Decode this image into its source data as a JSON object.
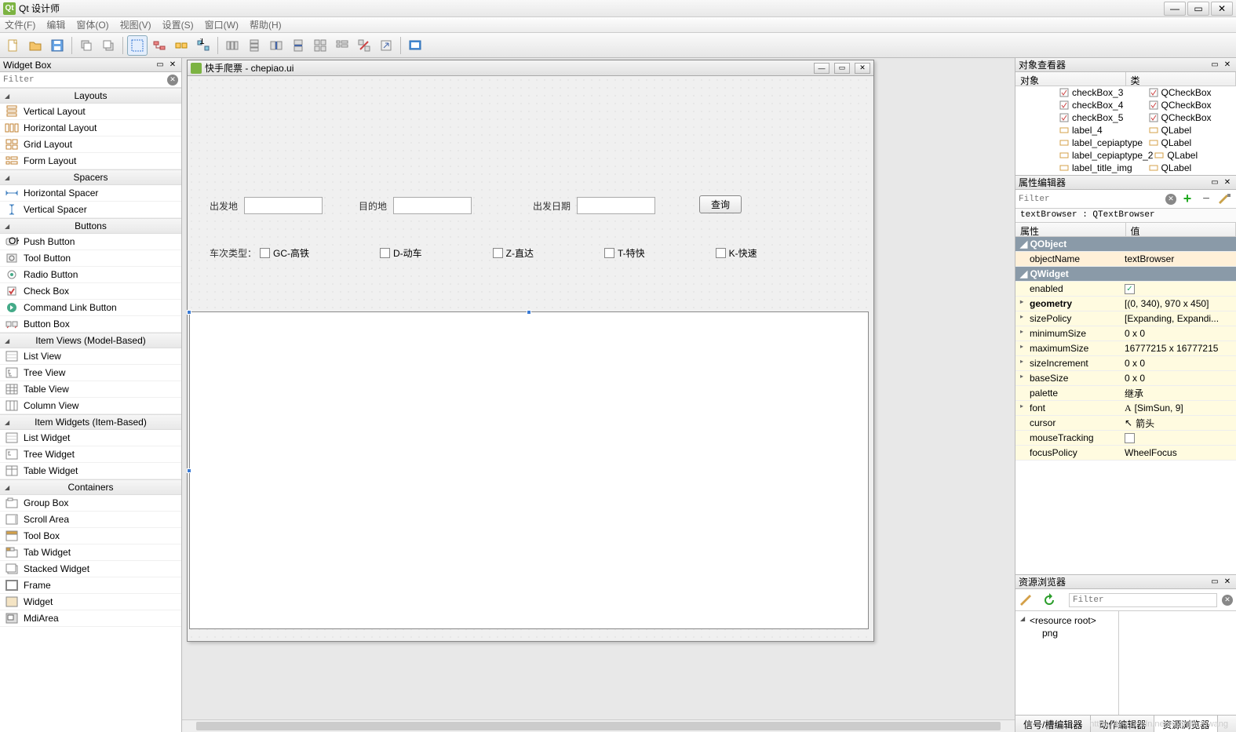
{
  "app": {
    "title": "Qt 设计师",
    "icon_letter": "Qt"
  },
  "window_buttons": {
    "min": "—",
    "max": "▭",
    "close": "✕"
  },
  "menu": [
    "文件(F)",
    "编辑",
    "窗体(O)",
    "视图(V)",
    "设置(S)",
    "窗口(W)",
    "帮助(H)"
  ],
  "widgetbox": {
    "title": "Widget Box",
    "filter_placeholder": "Filter",
    "categories": [
      {
        "name": "Layouts",
        "items": [
          "Vertical Layout",
          "Horizontal Layout",
          "Grid Layout",
          "Form Layout"
        ]
      },
      {
        "name": "Spacers",
        "items": [
          "Horizontal Spacer",
          "Vertical Spacer"
        ]
      },
      {
        "name": "Buttons",
        "items": [
          "Push Button",
          "Tool Button",
          "Radio Button",
          "Check Box",
          "Command Link Button",
          "Button Box"
        ]
      },
      {
        "name": "Item Views (Model-Based)",
        "items": [
          "List View",
          "Tree View",
          "Table View",
          "Column View"
        ]
      },
      {
        "name": "Item Widgets (Item-Based)",
        "items": [
          "List Widget",
          "Tree Widget",
          "Table Widget"
        ]
      },
      {
        "name": "Containers",
        "items": [
          "Group Box",
          "Scroll Area",
          "Tool Box",
          "Tab Widget",
          "Stacked Widget",
          "Frame",
          "Widget",
          "MdiArea"
        ]
      }
    ]
  },
  "design": {
    "window_title": "快手爬票 - chepiao.ui",
    "labels": {
      "depart": "出发地",
      "dest": "目的地",
      "date": "出发日期",
      "query": "查询",
      "train_type": "车次类型："
    },
    "checkboxes": [
      "GC-高铁",
      "D-动车",
      "Z-直达",
      "T-特快",
      "K-快速"
    ]
  },
  "object_inspector": {
    "title": "对象查看器",
    "columns": [
      "对象",
      "类"
    ],
    "rows": [
      {
        "name": "checkBox_3",
        "class": "QCheckBox",
        "icon": "check"
      },
      {
        "name": "checkBox_4",
        "class": "QCheckBox",
        "icon": "check"
      },
      {
        "name": "checkBox_5",
        "class": "QCheckBox",
        "icon": "check"
      },
      {
        "name": "label_4",
        "class": "QLabel",
        "icon": "label"
      },
      {
        "name": "label_cepiaptype",
        "class": "QLabel",
        "icon": "label"
      },
      {
        "name": "label_cepiaptype_2",
        "class": "QLabel",
        "icon": "label"
      },
      {
        "name": "label_title_img",
        "class": "QLabel",
        "icon": "label"
      }
    ]
  },
  "property_editor": {
    "title": "属性编辑器",
    "filter_placeholder": "Filter",
    "object_line": "textBrowser : QTextBrowser",
    "columns": [
      "属性",
      "值"
    ],
    "groups": [
      {
        "label": "QObject",
        "rows": [
          {
            "name": "objectName",
            "value": "textBrowser",
            "tint": "orange"
          }
        ]
      },
      {
        "label": "QWidget",
        "rows": [
          {
            "name": "enabled",
            "value": "",
            "check": true,
            "tint": "yellow"
          },
          {
            "name": "geometry",
            "value": "[(0, 340), 970 x 450]",
            "bold": true,
            "exp": true,
            "tint": "yellow"
          },
          {
            "name": "sizePolicy",
            "value": "[Expanding, Expandi...",
            "exp": true,
            "tint": "yellow"
          },
          {
            "name": "minimumSize",
            "value": "0 x 0",
            "exp": true,
            "tint": "yellow"
          },
          {
            "name": "maximumSize",
            "value": "16777215 x 16777215",
            "exp": true,
            "tint": "yellow"
          },
          {
            "name": "sizeIncrement",
            "value": "0 x 0",
            "exp": true,
            "tint": "yellow"
          },
          {
            "name": "baseSize",
            "value": "0 x 0",
            "exp": true,
            "tint": "yellow"
          },
          {
            "name": "palette",
            "value": "继承",
            "tint": "yellow"
          },
          {
            "name": "font",
            "value": "[SimSun, 9]",
            "exp": true,
            "tint": "yellow",
            "pre": "A"
          },
          {
            "name": "cursor",
            "value": "箭头",
            "tint": "yellow",
            "pre": "↖"
          },
          {
            "name": "mouseTracking",
            "value": "",
            "check": false,
            "tint": "yellow"
          },
          {
            "name": "focusPolicy",
            "value": "WheelFocus",
            "tint": "yellow"
          }
        ]
      }
    ]
  },
  "resource_browser": {
    "title": "资源浏览器",
    "filter_placeholder": "Filter",
    "tree": {
      "root": "<resource root>",
      "children": [
        "png"
      ]
    },
    "tabs": [
      "信号/槽编辑器",
      "动作编辑器",
      "资源浏览器"
    ],
    "active_tab": 2
  }
}
